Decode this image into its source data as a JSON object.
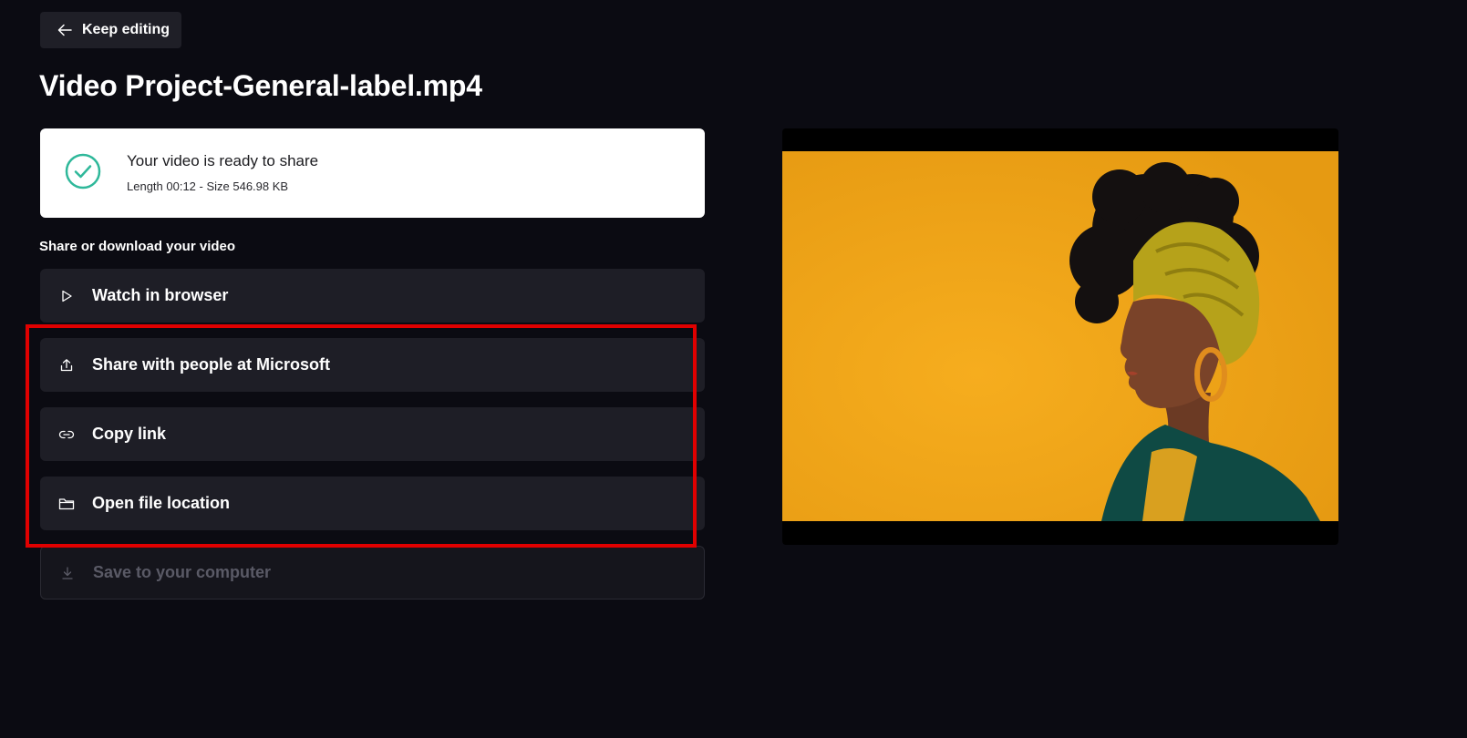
{
  "header": {
    "back_label": "Keep editing",
    "title": "Video Project-General-label.mp4"
  },
  "status": {
    "headline": "Your video is ready to share",
    "meta": "Length 00:12 - Size 546.98 KB",
    "icon": "check-circle-icon",
    "accent_color": "#2fb89a"
  },
  "share_section": {
    "label": "Share or download your video",
    "actions": [
      {
        "label": "Watch in browser",
        "icon": "play-icon",
        "enabled": true
      },
      {
        "label": "Share with people at Microsoft",
        "icon": "share-upload-icon",
        "enabled": true
      },
      {
        "label": "Copy link",
        "icon": "link-icon",
        "enabled": true
      },
      {
        "label": "Open file location",
        "icon": "folder-icon",
        "enabled": true
      },
      {
        "label": "Save to your computer",
        "icon": "download-icon",
        "enabled": false
      }
    ]
  },
  "preview": {
    "background_color": "#f1a51c",
    "highlight_color": "#e00000"
  }
}
